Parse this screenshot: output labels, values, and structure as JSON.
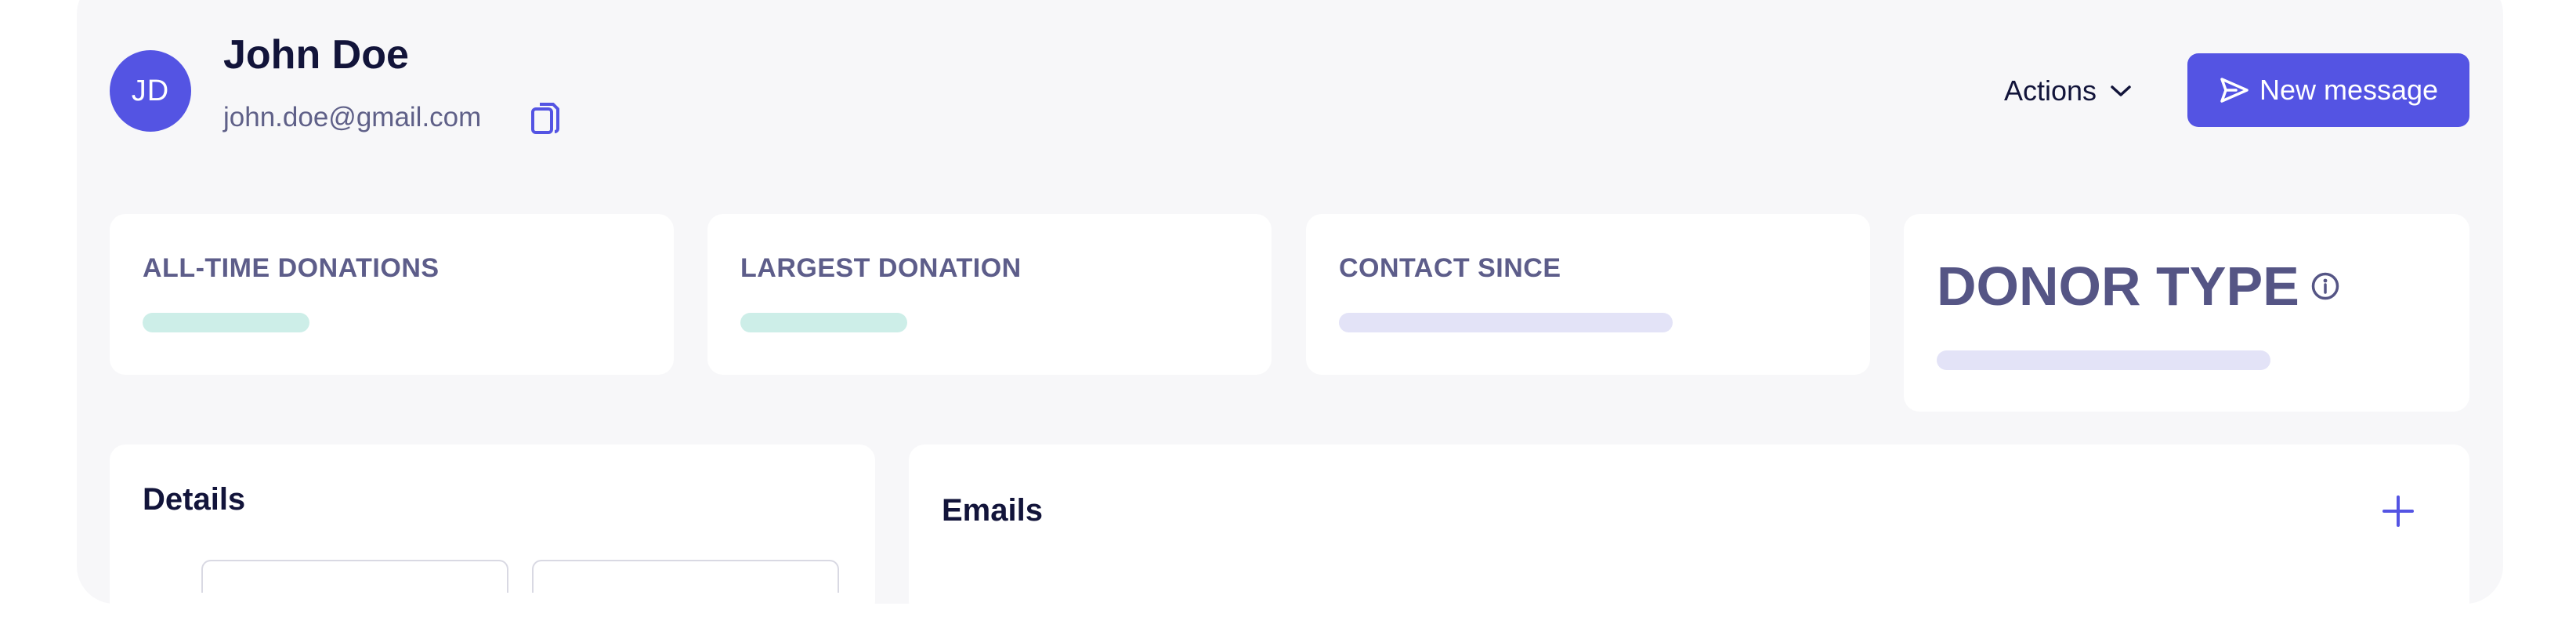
{
  "profile": {
    "initials": "JD",
    "name": "John Doe",
    "email": "john.doe@gmail.com"
  },
  "header": {
    "actions_label": "Actions",
    "new_message_label": "New message"
  },
  "stats": {
    "all_time_donations": {
      "label": "ALL-TIME DONATIONS"
    },
    "largest_donation": {
      "label": "LARGEST DONATION"
    },
    "contact_since": {
      "label": "CONTACT SINCE"
    },
    "donor_type": {
      "label": "DONOR TYPE"
    }
  },
  "sections": {
    "details_title": "Details",
    "emails_title": "Emails"
  },
  "colors": {
    "accent": "#5454e3",
    "skeleton_teal": "#cdeee8",
    "skeleton_lavender": "#e3e3f7",
    "panel_bg": "#f7f7f9"
  },
  "icons": {
    "copy": "copy-icon",
    "chevron": "chevron-down-icon",
    "send": "send-icon",
    "info": "info-icon",
    "add": "plus-icon"
  }
}
